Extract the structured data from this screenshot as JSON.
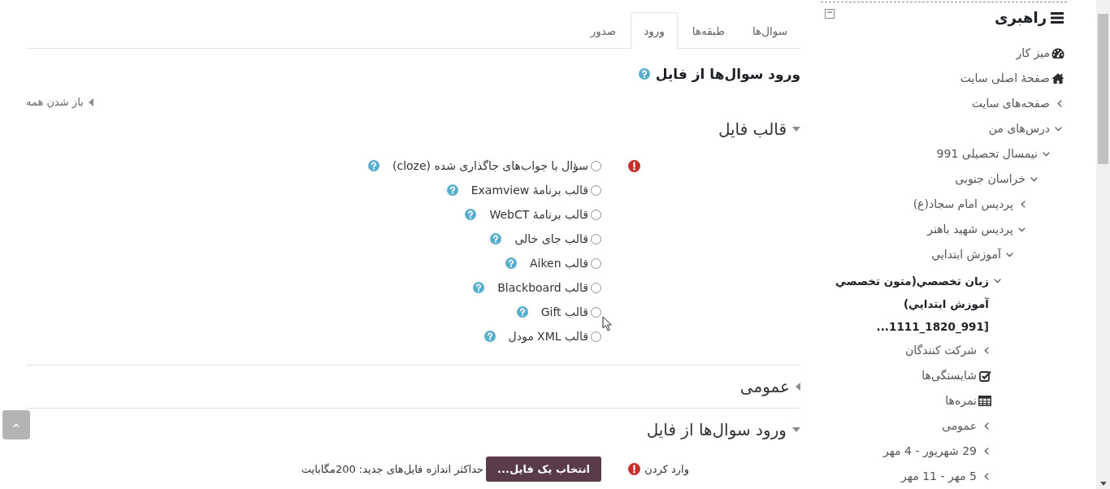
{
  "tabs": [
    {
      "label": "سوال‌ها",
      "selected": false
    },
    {
      "label": "طبقه‌ها",
      "selected": false
    },
    {
      "label": "ورود",
      "selected": true
    },
    {
      "label": "صدور",
      "selected": false
    }
  ],
  "page_heading": "ورود سوال‌ها از فایل",
  "form": {
    "expand_all": "باز شدن همه",
    "sections": [
      {
        "title": "قالب فایل",
        "expanded": true,
        "fields": [
          {
            "kind": "radio_group",
            "required": true,
            "options": [
              {
                "label": "سؤال با جواب‌های جاگذاری شده (cloze)",
                "selected": false
              },
              {
                "label": "قالب برنامهٔ Examview",
                "selected": false
              },
              {
                "label": "قالب برنامهٔ WebCT",
                "selected": false
              },
              {
                "label": "قالب جای خالی",
                "selected": false
              },
              {
                "label": "قالب Aiken",
                "selected": false
              },
              {
                "label": "قالب Blackboard",
                "selected": false
              },
              {
                "label": "قالب Gift",
                "selected": false
              },
              {
                "label": "قالب XML مودل",
                "selected": false
              }
            ]
          }
        ]
      },
      {
        "title": "عمومی",
        "expanded": false
      },
      {
        "title": "ورود سوال‌ها از فایل",
        "expanded": true,
        "fields": [
          {
            "kind": "filepicker",
            "label": "وارد کردن",
            "required": true,
            "button": "انتخاب یک فایل...",
            "note": "حداکثر اندازه فایل‌های جدید: 200مگابایت"
          }
        ]
      }
    ]
  },
  "sidebar": {
    "title": "راهبری",
    "items": [
      {
        "label": "میز کار",
        "kind": "dashboard",
        "current": false
      },
      {
        "label": "صفحهٔ اصلی سایت",
        "kind": "home",
        "current": false
      },
      {
        "label": "صفحه‌های سایت",
        "kind": "branch",
        "expanded": false,
        "current": false
      },
      {
        "label": "درس‌های من",
        "kind": "branch",
        "expanded": true,
        "current": false,
        "children": [
          {
            "label": "نیمسال تحصیلی 991",
            "kind": "branch",
            "expanded": true,
            "current": false,
            "children": [
              {
                "label": "خراسان جنوبی",
                "kind": "branch",
                "expanded": true,
                "current": false,
                "children": [
                  {
                    "label": "پردیس امام سجاد(ع)",
                    "kind": "branch",
                    "expanded": false,
                    "current": false
                  },
                  {
                    "label": "پردیس شهید باهنر",
                    "kind": "branch",
                    "expanded": true,
                    "current": false,
                    "children": [
                      {
                        "label": "آموزش ابتدايي",
                        "kind": "branch",
                        "expanded": true,
                        "current": false,
                        "children": [
                          {
                            "label": "زبان تخصصي(متون تخصصي آموزش ابتدايي) [991_1820_1111...",
                            "kind": "branch",
                            "expanded": true,
                            "current": true,
                            "children": [
                              {
                                "label": "شرکت کنندگان",
                                "kind": "branch",
                                "expanded": false,
                                "current": false
                              },
                              {
                                "label": "شایستگی‌ها",
                                "kind": "competencies",
                                "current": false
                              },
                              {
                                "label": "نمره‌ها",
                                "kind": "grades",
                                "current": false
                              },
                              {
                                "label": "عمومی",
                                "kind": "branch",
                                "expanded": false,
                                "current": false
                              },
                              {
                                "label": "29 شهریور - 4 مهر",
                                "kind": "branch",
                                "expanded": false,
                                "current": false
                              },
                              {
                                "label": "5 مهر - 11 مهر",
                                "kind": "branch",
                                "expanded": false,
                                "current": false
                              }
                            ]
                          }
                        ]
                      }
                    ]
                  }
                ]
              }
            ]
          }
        ]
      }
    ]
  }
}
